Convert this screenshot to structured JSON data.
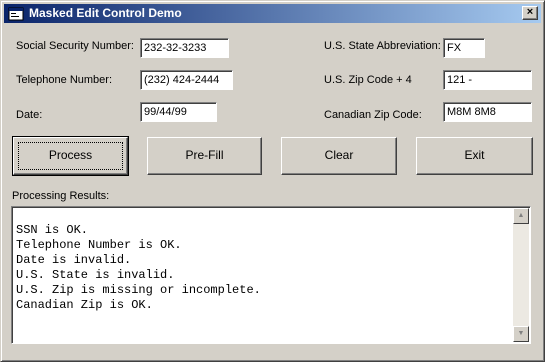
{
  "window": {
    "title": "Masked Edit Control Demo",
    "close_glyph": "×"
  },
  "fields": {
    "ssn": {
      "label": "Social Security Number:",
      "value": "232-32-3233"
    },
    "phone": {
      "label": "Telephone Number:",
      "value": "(232) 424-2444"
    },
    "date": {
      "label": "Date:",
      "value": "99/44/99"
    },
    "state": {
      "label": "U.S. State Abbreviation:",
      "value": "FX"
    },
    "zip": {
      "label": "U.S. Zip Code + 4",
      "value": "121  -"
    },
    "canadian_zip": {
      "label": "Canadian Zip Code:",
      "value": "M8M 8M8"
    }
  },
  "buttons": {
    "process": "Process",
    "prefill": "Pre-Fill",
    "clear": "Clear",
    "exit": "Exit"
  },
  "results": {
    "label": "Processing Results:",
    "text": "SSN is OK.\nTelephone Number is OK.\nDate is invalid.\nU.S. State is invalid.\nU.S. Zip is missing or incomplete.\nCanadian Zip is OK.",
    "scroll_up": "▲",
    "scroll_down": "▼"
  },
  "colors": {
    "titlebar_start": "#0a246a",
    "titlebar_end": "#a6caf0",
    "face": "#d4d0c8"
  }
}
